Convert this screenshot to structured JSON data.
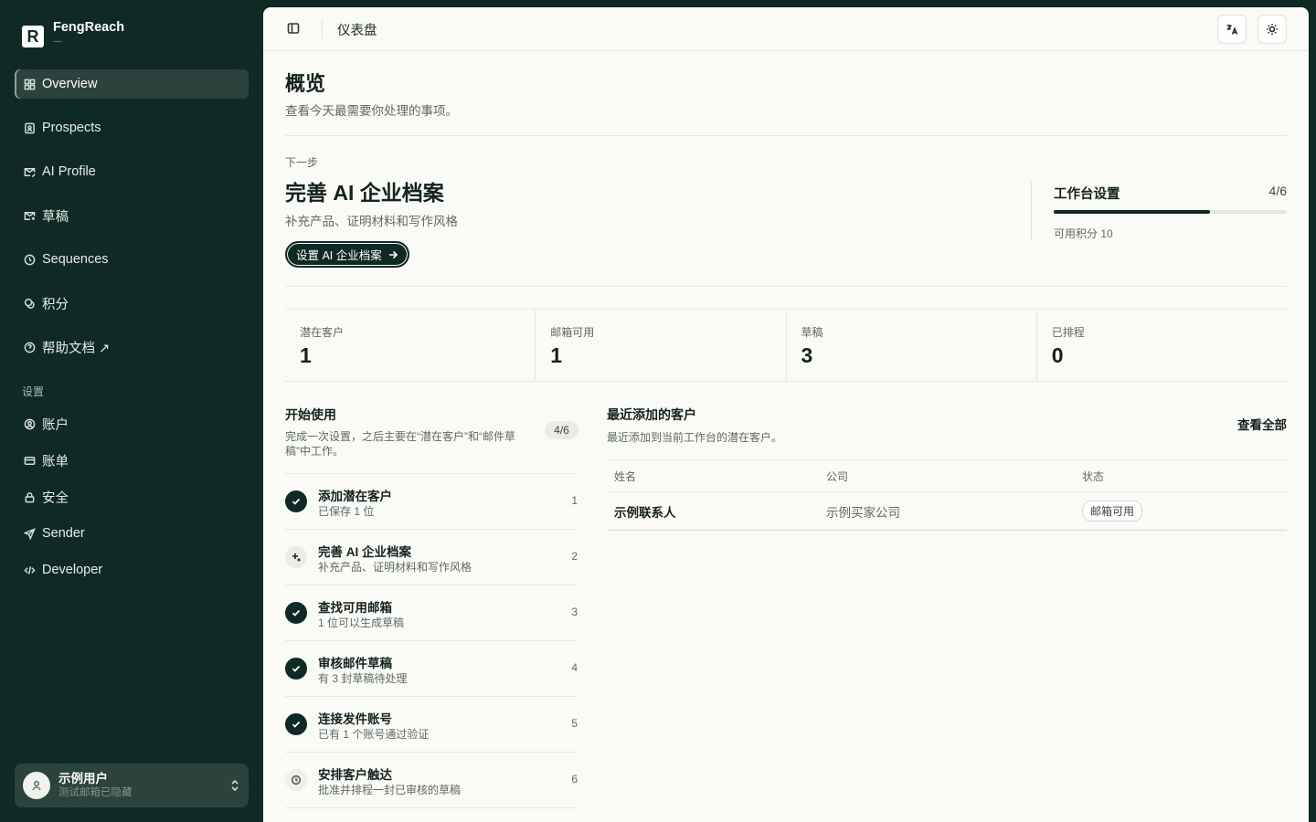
{
  "app": {
    "brand_name": "FengReach",
    "brand_sub": "—",
    "brand_logo_letter": "R"
  },
  "sidebar": {
    "items": [
      {
        "label": "Overview",
        "icon": "grid-icon",
        "active": true
      },
      {
        "label": "Prospects",
        "icon": "contact-card-icon"
      },
      {
        "label": "AI Profile",
        "icon": "mail-edit-icon"
      },
      {
        "label": "草稿",
        "icon": "mail-draft-icon"
      },
      {
        "label": "Sequences",
        "icon": "clock-icon"
      },
      {
        "label": "积分",
        "icon": "coins-icon"
      },
      {
        "label": "帮助文档 ↗",
        "icon": "help-circle-icon"
      }
    ],
    "settings_label": "设置",
    "settings_items": [
      {
        "label": "账户",
        "icon": "user-circle-icon"
      },
      {
        "label": "账单",
        "icon": "credit-card-icon"
      },
      {
        "label": "安全",
        "icon": "lock-icon"
      },
      {
        "label": "Sender",
        "icon": "send-icon"
      },
      {
        "label": "Developer",
        "icon": "code-icon"
      }
    ],
    "user": {
      "name": "示例用户",
      "email": "测试邮箱已隐藏"
    }
  },
  "topbar": {
    "title": "仪表盘"
  },
  "page": {
    "title": "概览",
    "subtitle": "查看今天最需要你处理的事项。"
  },
  "next_step": {
    "label": "下一步",
    "title": "完善 AI 企业档案",
    "subtitle": "补充产品、证明材料和写作风格",
    "button_label": "设置 AI 企业档案"
  },
  "setup": {
    "title": "工作台设置",
    "count": "4/6",
    "progress": 0.67,
    "credits": "可用积分 10"
  },
  "stats": [
    {
      "label": "潜在客户",
      "value": "1"
    },
    {
      "label": "邮箱可用",
      "value": "1"
    },
    {
      "label": "草稿",
      "value": "3"
    },
    {
      "label": "已排程",
      "value": "0"
    }
  ],
  "getting_started": {
    "title": "开始使用",
    "subtitle": "完成一次设置，之后主要在“潜在客户”和“邮件草稿”中工作。",
    "badge": "4/6",
    "steps": [
      {
        "title": "添加潜在客户",
        "sub": "已保存 1 位",
        "num": "1",
        "state": "done"
      },
      {
        "title": "完善 AI 企业档案",
        "sub": "补充产品、证明材料和写作风格",
        "num": "2",
        "state": "current"
      },
      {
        "title": "查找可用邮箱",
        "sub": "1 位可以生成草稿",
        "num": "3",
        "state": "done"
      },
      {
        "title": "审核邮件草稿",
        "sub": "有 3 封草稿待处理",
        "num": "4",
        "state": "done"
      },
      {
        "title": "连接发件账号",
        "sub": "已有 1 个账号通过验证",
        "num": "5",
        "state": "done"
      },
      {
        "title": "安排客户触达",
        "sub": "批准并排程一封已审核的草稿",
        "num": "6",
        "state": "pending"
      }
    ]
  },
  "recent": {
    "title": "最近添加的客户",
    "subtitle": "最近添加到当前工作台的潜在客户。",
    "view_all": "查看全部",
    "columns": [
      "姓名",
      "公司",
      "状态"
    ],
    "rows": [
      {
        "name": "示例联系人",
        "company": "示例买家公司",
        "status": "邮箱可用"
      }
    ]
  }
}
